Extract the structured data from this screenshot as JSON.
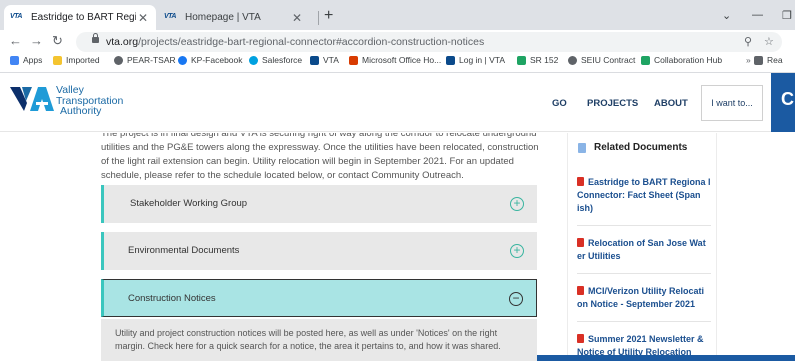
{
  "browser": {
    "tabs": [
      {
        "title": "Eastridge to BART Regional Conr",
        "favicon": "VTA"
      },
      {
        "title": "Homepage | VTA",
        "favicon": "VTA"
      }
    ],
    "url_host": "vta.org",
    "url_path": "/projects/eastridge-bart-regional-connector#accordion-construction-notices",
    "bookmarks": [
      {
        "label": "Apps",
        "icon": "apps-icon",
        "color": "#4285f4"
      },
      {
        "label": "Imported",
        "icon": "folder-icon",
        "color": "#f4c430"
      },
      {
        "label": "PEAR-TSAR",
        "icon": "globe-icon",
        "color": "#5f6368"
      },
      {
        "label": "KP-Facebook",
        "icon": "facebook-icon",
        "color": "#1877f2"
      },
      {
        "label": "Salesforce",
        "icon": "salesforce-icon",
        "color": "#00a1e0"
      },
      {
        "label": "VTA",
        "icon": "vta-icon",
        "color": "#0b4a8b"
      },
      {
        "label": "Microsoft Office Ho...",
        "icon": "office-icon",
        "color": "#d83b01"
      },
      {
        "label": "Log in | VTA",
        "icon": "vta-icon",
        "color": "#0b4a8b"
      },
      {
        "label": "SR 152",
        "icon": "drive-icon",
        "color": "#1fa463"
      },
      {
        "label": "SEIU Contract",
        "icon": "globe-icon",
        "color": "#5f6368"
      },
      {
        "label": "Collaboration Hub",
        "icon": "drive-icon",
        "color": "#1fa463"
      },
      {
        "label": "Rea",
        "icon": "reading-list-icon",
        "color": "#5f6368"
      }
    ]
  },
  "site": {
    "logo_line1": "Valley",
    "logo_line2": "Transportation",
    "logo_line3": "Authority",
    "nav": [
      "GO",
      "PROJECTS",
      "ABOUT"
    ],
    "iwant": "I want to...",
    "brand_color": "#1b5aa2",
    "accent_color": "#3ac6be"
  },
  "main": {
    "intro_text": "The project is in final design and VTA is securing right of way along the corridor to relocate underground utilities and the PG&E towers along the expressway. Once the utilities have been relocated, construction of the light rail extension can begin. Utility relocation will begin in September 2021. For an updated schedule, please refer to the schedule located below, or contact Community Outreach.",
    "accordions": [
      {
        "label": "Stakeholder Working Group",
        "state": "collapsed"
      },
      {
        "label": "Environmental Documents",
        "state": "collapsed"
      },
      {
        "label": "Construction Notices",
        "state": "expanded"
      }
    ],
    "notices_text": "Utility and project construction notices will be posted here, as well as under 'Notices' on the right margin. Check here for a quick search for a notice, the area it pertains to, and how it was shared."
  },
  "sidebar": {
    "title": "Related Documents",
    "docs": [
      "Eastridge to BART Regiona l Connector: Fact Sheet (Span ish)",
      "Relocation of San Jose Wat er Utilities",
      "MCI/Verizon Utility Relocati on Notice - September 2021",
      "Summer 2021 Newsletter & Notice of Utility Relocation"
    ]
  }
}
